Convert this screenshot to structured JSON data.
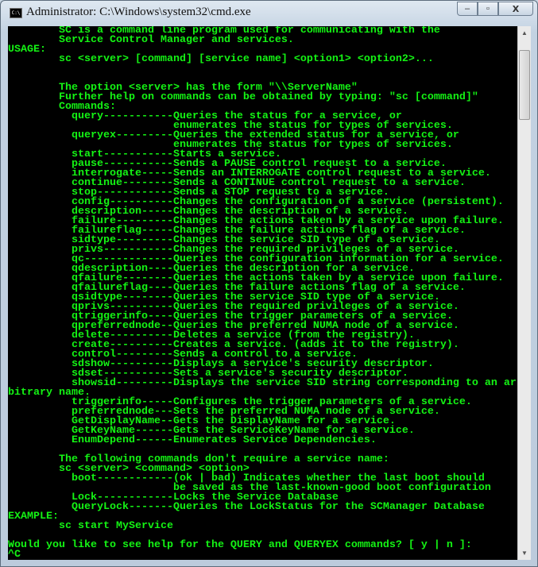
{
  "window": {
    "title": "Administrator: C:\\Windows\\system32\\cmd.exe",
    "app_icon_text": "C:\\",
    "buttons": {
      "minimize": "–",
      "maximize": "▫",
      "close": "X"
    }
  },
  "console": {
    "text_color": "#14f314",
    "background": "#000000",
    "lines": [
      "        SC is a command line program used for communicating with the",
      "        Service Control Manager and services.",
      "USAGE:",
      "        sc <server> [command] [service name] <option1> <option2>...",
      "",
      "",
      "        The option <server> has the form \"\\\\ServerName\"",
      "        Further help on commands can be obtained by typing: \"sc [command]\"",
      "        Commands:",
      "          query-----------Queries the status for a service, or",
      "                          enumerates the status for types of services.",
      "          queryex---------Queries the extended status for a service, or",
      "                          enumerates the status for types of services.",
      "          start-----------Starts a service.",
      "          pause-----------Sends a PAUSE control request to a service.",
      "          interrogate-----Sends an INTERROGATE control request to a service.",
      "          continue--------Sends a CONTINUE control request to a service.",
      "          stop------------Sends a STOP request to a service.",
      "          config----------Changes the configuration of a service (persistent).",
      "          description-----Changes the description of a service.",
      "          failure---------Changes the actions taken by a service upon failure.",
      "          failureflag-----Changes the failure actions flag of a service.",
      "          sidtype---------Changes the service SID type of a service.",
      "          privs-----------Changes the required privileges of a service.",
      "          qc--------------Queries the configuration information for a service.",
      "          qdescription----Queries the description for a service.",
      "          qfailure--------Queries the actions taken by a service upon failure.",
      "          qfailureflag----Queries the failure actions flag of a service.",
      "          qsidtype--------Queries the service SID type of a service.",
      "          qprivs----------Queries the required privileges of a service.",
      "          qtriggerinfo----Queries the trigger parameters of a service.",
      "          qpreferrednode--Queries the preferred NUMA node of a service.",
      "          delete----------Deletes a service (from the registry).",
      "          create----------Creates a service. (adds it to the registry).",
      "          control---------Sends a control to a service.",
      "          sdshow----------Displays a service's security descriptor.",
      "          sdset-----------Sets a service's security descriptor.",
      "          showsid---------Displays the service SID string corresponding to an ar",
      "bitrary name.",
      "          triggerinfo-----Configures the trigger parameters of a service.",
      "          preferrednode---Sets the preferred NUMA node of a service.",
      "          GetDisplayName--Gets the DisplayName for a service.",
      "          GetKeyName------Gets the ServiceKeyName for a service.",
      "          EnumDepend------Enumerates Service Dependencies.",
      "",
      "        The following commands don't require a service name:",
      "        sc <server> <command> <option>",
      "          boot------------(ok | bad) Indicates whether the last boot should",
      "                          be saved as the last-known-good boot configuration",
      "          Lock------------Locks the Service Database",
      "          QueryLock-------Queries the LockStatus for the SCManager Database",
      "EXAMPLE:",
      "        sc start MyService",
      "",
      "Would you like to see help for the QUERY and QUERYEX commands? [ y | n ]:",
      "^C"
    ]
  },
  "scrollbar": {
    "position_fraction": 0.0,
    "up_arrow": "▲",
    "down_arrow": "▼"
  }
}
